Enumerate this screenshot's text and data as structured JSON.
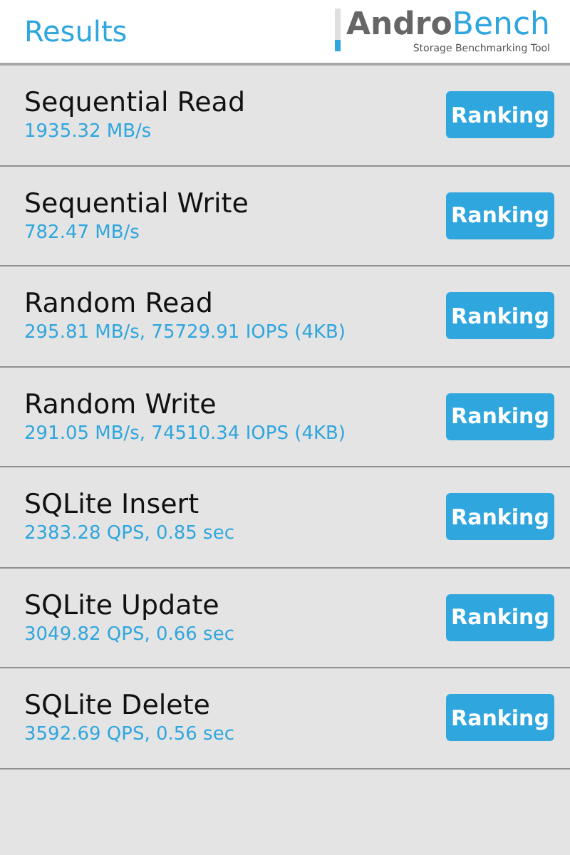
{
  "header": {
    "title": "Results",
    "logo": {
      "part_1": "Andro",
      "part_2": "Bench",
      "tagline": "Storage Benchmarking Tool"
    }
  },
  "results": [
    {
      "name": "Sequential Read",
      "value": "1935.32 MB/s",
      "button": "Ranking"
    },
    {
      "name": "Sequential Write",
      "value": "782.47 MB/s",
      "button": "Ranking"
    },
    {
      "name": "Random Read",
      "value": "295.81 MB/s, 75729.91 IOPS (4KB)",
      "button": "Ranking"
    },
    {
      "name": "Random Write",
      "value": "291.05 MB/s, 74510.34 IOPS (4KB)",
      "button": "Ranking"
    },
    {
      "name": "SQLite Insert",
      "value": "2383.28 QPS, 0.85 sec",
      "button": "Ranking"
    },
    {
      "name": "SQLite Update",
      "value": "3049.82 QPS, 0.66 sec",
      "button": "Ranking"
    },
    {
      "name": "SQLite Delete",
      "value": "3592.69 QPS, 0.56 sec",
      "button": "Ranking"
    }
  ]
}
